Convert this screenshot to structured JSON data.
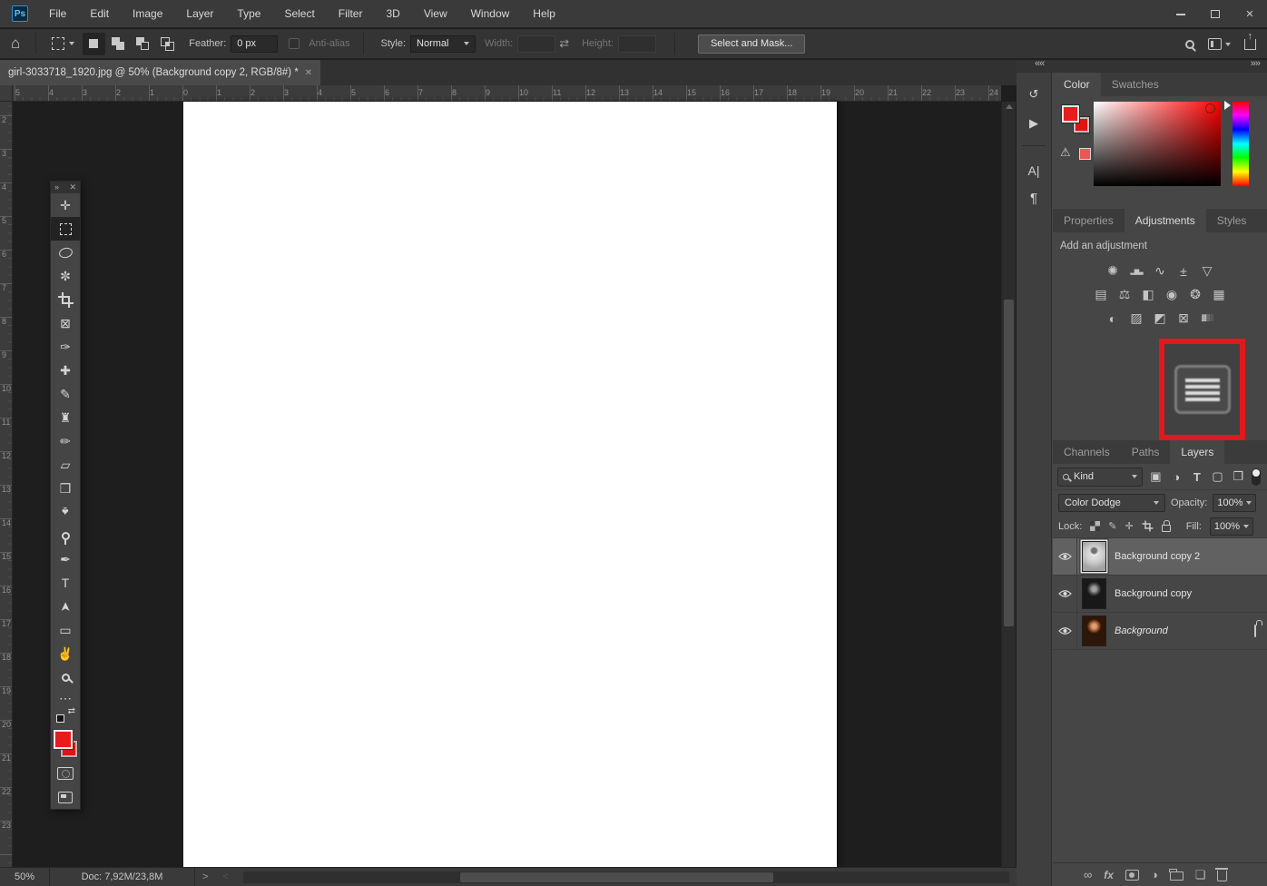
{
  "titlebar": {
    "logo": "Ps",
    "menus": [
      "File",
      "Edit",
      "Image",
      "Layer",
      "Type",
      "Select",
      "Filter",
      "3D",
      "View",
      "Window",
      "Help"
    ]
  },
  "options_bar": {
    "feather_label": "Feather:",
    "feather_value": "0 px",
    "anti_alias_label": "Anti-alias",
    "style_label": "Style:",
    "style_value": "Normal",
    "width_label": "Width:",
    "width_value": "",
    "height_label": "Height:",
    "height_value": "",
    "select_and_mask_label": "Select and Mask..."
  },
  "document": {
    "tab_title": "girl-3033718_1920.jpg @ 50% (Background copy 2, RGB/8#) *",
    "ruler_h": [
      "5",
      "4",
      "3",
      "2",
      "1",
      "0",
      "1",
      "2",
      "3",
      "4",
      "5",
      "6",
      "7",
      "8",
      "9",
      "10",
      "11",
      "12",
      "13",
      "14",
      "15",
      "16",
      "17",
      "18",
      "19",
      "20",
      "21",
      "22",
      "23",
      "24"
    ],
    "ruler_v": [
      "2",
      "3",
      "4",
      "5",
      "6",
      "7",
      "8",
      "9",
      "10",
      "11",
      "12",
      "13",
      "14",
      "15",
      "16",
      "17",
      "18",
      "19",
      "20",
      "21",
      "22",
      "23"
    ]
  },
  "toolbar": {
    "tools": [
      {
        "name": "move-tool",
        "glyph": "✛"
      },
      {
        "name": "rectangular-marquee-tool",
        "shape": "marquee",
        "selected": true
      },
      {
        "name": "lasso-tool",
        "shape": "lasso"
      },
      {
        "name": "magic-wand-tool",
        "glyph": "✼"
      },
      {
        "name": "crop-tool",
        "shape": "crop"
      },
      {
        "name": "frame-tool",
        "glyph": "⊠"
      },
      {
        "name": "eyedropper-tool",
        "glyph": "✑"
      },
      {
        "name": "spot-healing-brush-tool",
        "glyph": "✚"
      },
      {
        "name": "brush-tool",
        "glyph": "✎"
      },
      {
        "name": "clone-stamp-tool",
        "glyph": "♜"
      },
      {
        "name": "history-brush-tool",
        "glyph": "✏"
      },
      {
        "name": "eraser-tool",
        "glyph": "▱"
      },
      {
        "name": "paint-bucket-tool",
        "glyph": "❒"
      },
      {
        "name": "blur-tool",
        "glyph": "♠",
        "rot": 180
      },
      {
        "name": "dodge-tool",
        "shape": "dodge"
      },
      {
        "name": "pen-tool",
        "glyph": "✒"
      },
      {
        "name": "type-tool",
        "glyph": "T"
      },
      {
        "name": "path-selection-tool",
        "glyph": "➤",
        "rot": -90
      },
      {
        "name": "rectangle-tool",
        "glyph": "▭"
      },
      {
        "name": "hand-tool",
        "glyph": "✌"
      },
      {
        "name": "zoom-tool",
        "shape": "zoom"
      },
      {
        "name": "edit-toolbar",
        "glyph": "⋯",
        "small": true
      },
      {
        "name": "default-colors",
        "shape": "minicolors",
        "small": true
      },
      {
        "name": "foreground-background-swatches",
        "shape": "swatches",
        "big": true
      },
      {
        "name": "quick-mask-mode",
        "shape": "quickmask"
      },
      {
        "name": "screen-mode",
        "shape": "screenmode"
      }
    ]
  },
  "panels": {
    "color": {
      "tab_color": "Color",
      "tab_swatches": "Swatches"
    },
    "adjustments": {
      "tab_properties": "Properties",
      "tab_adjustments": "Adjustments",
      "tab_styles": "Styles",
      "add_label": "Add an adjustment",
      "rows": [
        [
          {
            "name": "brightness-contrast",
            "glyph": "✺"
          },
          {
            "name": "levels",
            "glyph": "▂▆▃"
          },
          {
            "name": "curves",
            "glyph": "∿"
          },
          {
            "name": "exposure",
            "glyph": "±"
          },
          {
            "name": "vibrance",
            "glyph": "▽"
          }
        ],
        [
          {
            "name": "hue-saturation",
            "glyph": "▤"
          },
          {
            "name": "color-balance",
            "glyph": "⚖"
          },
          {
            "name": "black-and-white",
            "glyph": "◧"
          },
          {
            "name": "photo-filter",
            "glyph": "◉"
          },
          {
            "name": "channel-mixer",
            "glyph": "❂"
          },
          {
            "name": "color-lookup",
            "glyph": "▦"
          }
        ],
        [
          {
            "name": "invert",
            "glyph": "◐"
          },
          {
            "name": "posterize",
            "glyph": "▨"
          },
          {
            "name": "threshold",
            "glyph": "◩"
          },
          {
            "name": "selective-color",
            "glyph": "⊠"
          },
          {
            "name": "gradient-map",
            "glyph": "▓▒░"
          }
        ]
      ]
    },
    "layers": {
      "tab_channels": "Channels",
      "tab_paths": "Paths",
      "tab_layers": "Layers",
      "filter_kind": "Kind",
      "blend_mode": "Color Dodge",
      "opacity_label": "Opacity:",
      "opacity_value": "100%",
      "lock_label": "Lock:",
      "fill_label": "Fill:",
      "fill_value": "100%",
      "rows": [
        {
          "name": "Background copy 2",
          "selected": true,
          "locked": false
        },
        {
          "name": "Background copy",
          "selected": false,
          "locked": false
        },
        {
          "name": "Background",
          "selected": false,
          "locked": true
        }
      ]
    }
  },
  "status_bar": {
    "zoom_level": "50%",
    "doc_info": "Doc: 7,92M/23,8M"
  },
  "icons": {
    "close": "✕",
    "home": "⌂",
    "swap_dims": "⇄",
    "collapse": "««",
    "expand": "»»",
    "toolbar_collapse": "»",
    "toolbar_close": "✕",
    "history": "↺",
    "actions": "▶",
    "character": "A|",
    "paragraph": "¶",
    "warning": "⚠",
    "link": "∞",
    "fx": "fx",
    "adjustment_half": "◑",
    "new_layer": "❏",
    "filter_pixel": "▣",
    "filter_type": "T",
    "filter_shape": "▢",
    "filter_smart": "❐",
    "lock_brush": "✎",
    "lock_move": "✛",
    "chev_right": ">",
    "chev_left": "<"
  },
  "colors": {
    "foreground_red": "#e81c1c",
    "highlight_red": "#e0191c",
    "canvas_white": "#ffffff"
  }
}
